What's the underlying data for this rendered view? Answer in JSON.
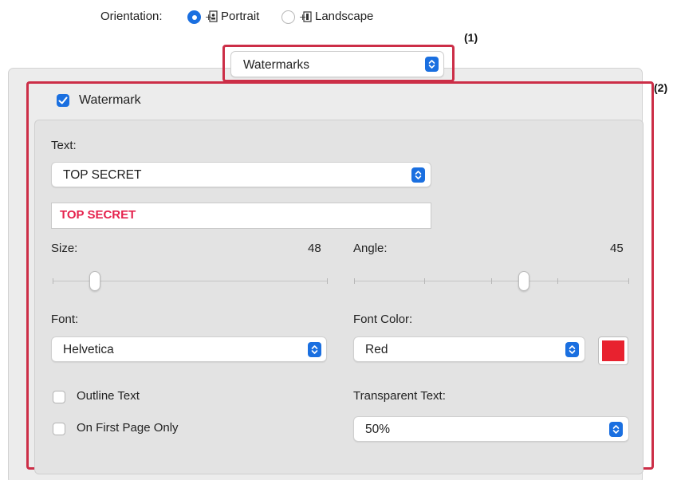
{
  "orientation": {
    "label": "Orientation:",
    "options": [
      {
        "label": "Portrait",
        "selected": true,
        "icon": "portrait-icon"
      },
      {
        "label": "Landscape",
        "selected": false,
        "icon": "landscape-icon"
      }
    ]
  },
  "panel_popup": {
    "value": "Watermarks"
  },
  "callouts": {
    "one": "(1)",
    "two": "(2)"
  },
  "watermark": {
    "checkbox_label": "Watermark",
    "checked": true,
    "text_label": "Text:",
    "text_popup": "TOP SECRET",
    "text_field": "TOP SECRET",
    "size_label": "Size:",
    "size_value": "48",
    "angle_label": "Angle:",
    "angle_value": "45",
    "font_label": "Font:",
    "font_popup": "Helvetica",
    "font_color_label": "Font Color:",
    "font_color_popup": "Red",
    "outline_label": "Outline Text",
    "first_page_label": "On First Page Only",
    "transparent_label": "Transparent Text:",
    "transparent_popup": "50%"
  },
  "colors": {
    "accent": "#1a6fe0",
    "callout": "#cc2e47",
    "field_text": "#e5234e",
    "swatch": "#e8222f"
  }
}
